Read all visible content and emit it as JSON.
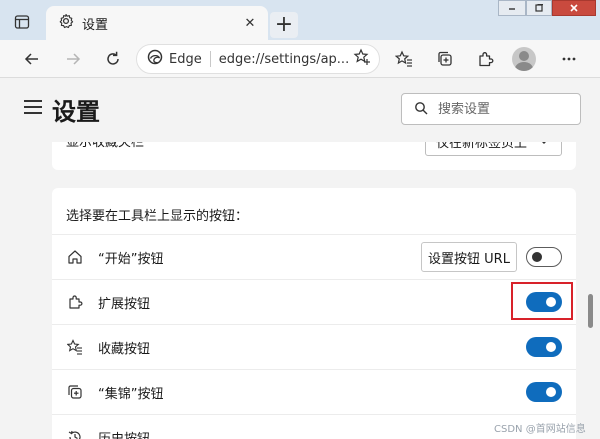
{
  "browser": {
    "tab": {
      "title": "设置",
      "close_label": "✕",
      "icon": "gear-icon"
    },
    "new_tab_label": "+",
    "window_controls": {
      "minimize_icon": "minimize-icon",
      "maximize_icon": "maximize-icon",
      "close_icon": "close-icon"
    },
    "address_bar": {
      "site_name": "Edge",
      "url": "edge://settings/ap..."
    },
    "toolbar_icons": [
      "back-icon",
      "forward-icon",
      "refresh-icon",
      "add-favorite-icon",
      "favorites-icon",
      "collections-icon",
      "extensions-icon",
      "avatar",
      "more-icon"
    ]
  },
  "settings": {
    "title": "设置",
    "search": {
      "placeholder": "搜索设置"
    },
    "favorites_bar_row": {
      "label": "显示收藏夹栏",
      "dropdown_value": "仅在新标签页上"
    },
    "toolbar_section": {
      "heading": "选择要在工具栏上显示的按钮：",
      "rows": [
        {
          "label": "“开始”按钮",
          "icon": "home-icon",
          "button_label": "设置按钮 URL",
          "toggle_on": false
        },
        {
          "label": "扩展按钮",
          "icon": "extensions-icon",
          "toggle_on": true,
          "highlighted": true
        },
        {
          "label": "收藏按钮",
          "icon": "favorites-icon",
          "toggle_on": true
        },
        {
          "label": "“集锦”按钮",
          "icon": "collections-icon",
          "toggle_on": true
        },
        {
          "label": "历史按钮",
          "icon": "history-icon"
        }
      ]
    }
  },
  "watermark": "CSDN @首网站信息",
  "colors": {
    "accent": "#0f6cbd",
    "highlight_box": "#d8222a",
    "tabstrip": "#d8e4f0"
  }
}
